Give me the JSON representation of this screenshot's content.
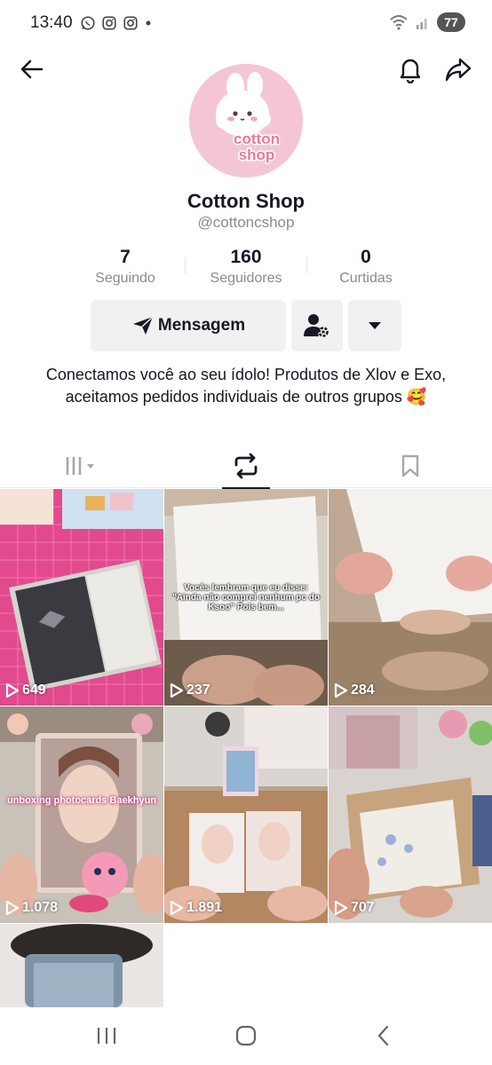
{
  "status_bar": {
    "time": "13:40",
    "left_icons": [
      "whatsapp-icon",
      "instagram-icon",
      "instagram-icon",
      "dot-icon"
    ],
    "right_icons": [
      "wifi-icon",
      "signal-icon"
    ],
    "battery": "77"
  },
  "nav": {
    "left_icon": "back-arrow-icon",
    "right_icons": [
      "bell-icon",
      "share-icon"
    ]
  },
  "profile": {
    "avatar_text_line1": "cotton",
    "avatar_text_line2": "shop",
    "name": "Cotton Shop",
    "handle": "@cottoncshop"
  },
  "stats": [
    {
      "value": "7",
      "label": "Seguindo"
    },
    {
      "value": "160",
      "label": "Seguidores"
    },
    {
      "value": "0",
      "label": "Curtidas"
    }
  ],
  "actions": {
    "message_label": "Mensagem",
    "message_icon": "send-icon",
    "add_friend_icon": "person-gear-icon",
    "more_icon": "caret-down-icon"
  },
  "bio": "Conectamos você ao seu ídolo! Produtos de Xlov e Exo, aceitamos pedidos individuais de outros grupos 🥰",
  "tabs": [
    {
      "icon": "grid-icon",
      "active": false
    },
    {
      "icon": "repost-icon",
      "active": true
    },
    {
      "icon": "bookmark-icon",
      "active": false
    }
  ],
  "videos": [
    {
      "views": "649",
      "caption": ""
    },
    {
      "views": "237",
      "caption": "Vocês lembram que eu disse: \"Ainda não comprei nenhum pc do Ksoo\" Pois bem..."
    },
    {
      "views": "284",
      "caption": ""
    },
    {
      "views": "1.078",
      "caption": "unboxing photocards Baekhyun"
    },
    {
      "views": "1.891",
      "caption": ""
    },
    {
      "views": "707",
      "caption": ""
    },
    {
      "views": "",
      "caption": ""
    }
  ],
  "bottom_nav": {
    "icons": [
      "recent-apps-icon",
      "home-icon",
      "back-icon"
    ]
  },
  "colors": {
    "text": "#161823",
    "muted": "#8a8b91",
    "button_bg": "#f1f1f2",
    "avatar_bg": "#f4c6d3",
    "avatar_accent": "#e8799b"
  }
}
